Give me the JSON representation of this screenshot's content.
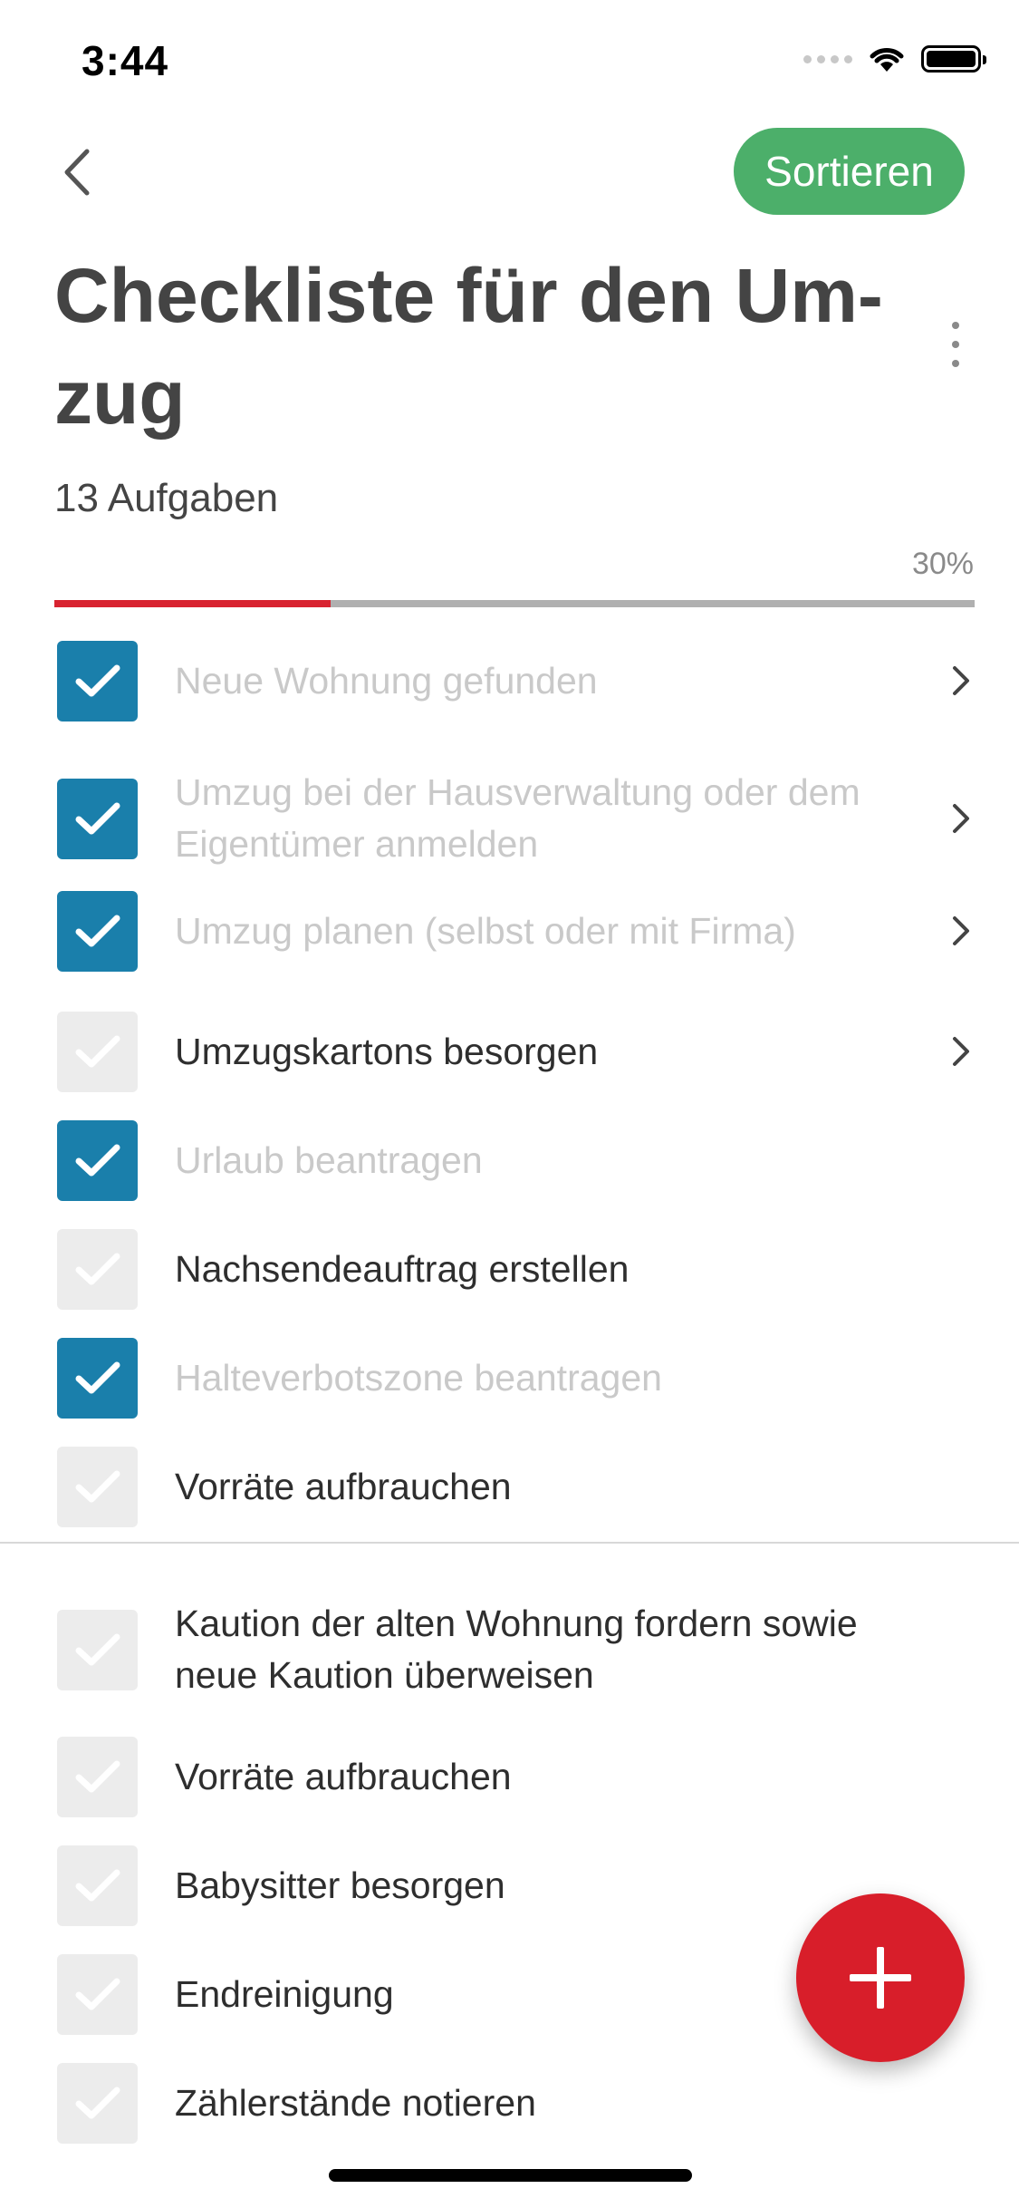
{
  "status_bar": {
    "time": "3:44"
  },
  "header": {
    "back_icon": "chevron-left-icon",
    "sort_label": "Sortieren",
    "sort_color": "#4caf6a"
  },
  "title": "Checkliste für den Um-zug",
  "task_count": "13 Aufgaben",
  "progress": {
    "label": "30%",
    "fraction": 0.3,
    "fill_color": "#d82330"
  },
  "tasks": [
    {
      "label": "Neue Wohnung gefunden",
      "checked": true,
      "has_details": true
    },
    {
      "label": "Umzug bei der Hausverwaltung oder dem Eigentümer anmelden",
      "checked": true,
      "has_details": true
    },
    {
      "label": "Umzug planen (selbst oder mit Firma)",
      "checked": true,
      "has_details": true
    },
    {
      "label": "Umzugskartons besorgen",
      "checked": false,
      "has_details": true
    },
    {
      "label": "Urlaub beantragen",
      "checked": true,
      "has_details": false
    },
    {
      "label": "Nachsendeauftrag erstellen",
      "checked": false,
      "has_details": false
    },
    {
      "label": "Halteverbotszone beantragen",
      "checked": true,
      "has_details": false
    },
    {
      "label": "Vorräte aufbrauchen",
      "checked": false,
      "has_details": false
    },
    {
      "label": "Kaution der alten Wohnung fordern sowie neue Kaution überweisen",
      "checked": false,
      "has_details": false
    },
    {
      "label": "Vorräte aufbrauchen",
      "checked": false,
      "has_details": false
    },
    {
      "label": "Babysitter besorgen",
      "checked": false,
      "has_details": false
    },
    {
      "label": "Endreinigung",
      "checked": false,
      "has_details": false
    },
    {
      "label": "Zählerstände notieren",
      "checked": false,
      "has_details": false
    }
  ],
  "fab": {
    "icon": "plus-icon",
    "color": "#d81e2a"
  }
}
